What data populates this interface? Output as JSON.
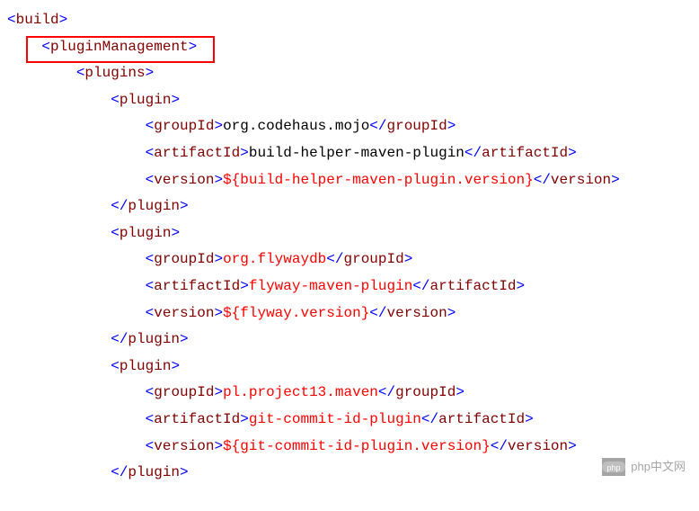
{
  "tags": {
    "build_open": "build",
    "pluginManagement_open": "pluginManagement",
    "plugins_open": "plugins",
    "plugin_open": "plugin",
    "plugin_close": "plugin",
    "groupId_open": "groupId",
    "groupId_close": "groupId",
    "artifactId_open": "artifactId",
    "artifactId_close": "artifactId",
    "version_open": "version",
    "version_close": "version"
  },
  "plugin1": {
    "groupId": "org.codehaus.mojo",
    "artifactId": "build-helper-maven-plugin",
    "version": "${build-helper-maven-plugin.version}"
  },
  "plugin2": {
    "groupId": "org.flywaydb",
    "artifactId": "flyway-maven-plugin",
    "version": "${flyway.version}"
  },
  "plugin3": {
    "groupId": "pl.project13.maven",
    "artifactId": "git-commit-id-plugin",
    "version": "${git-commit-id-plugin.version}"
  },
  "watermark": "php中文网"
}
